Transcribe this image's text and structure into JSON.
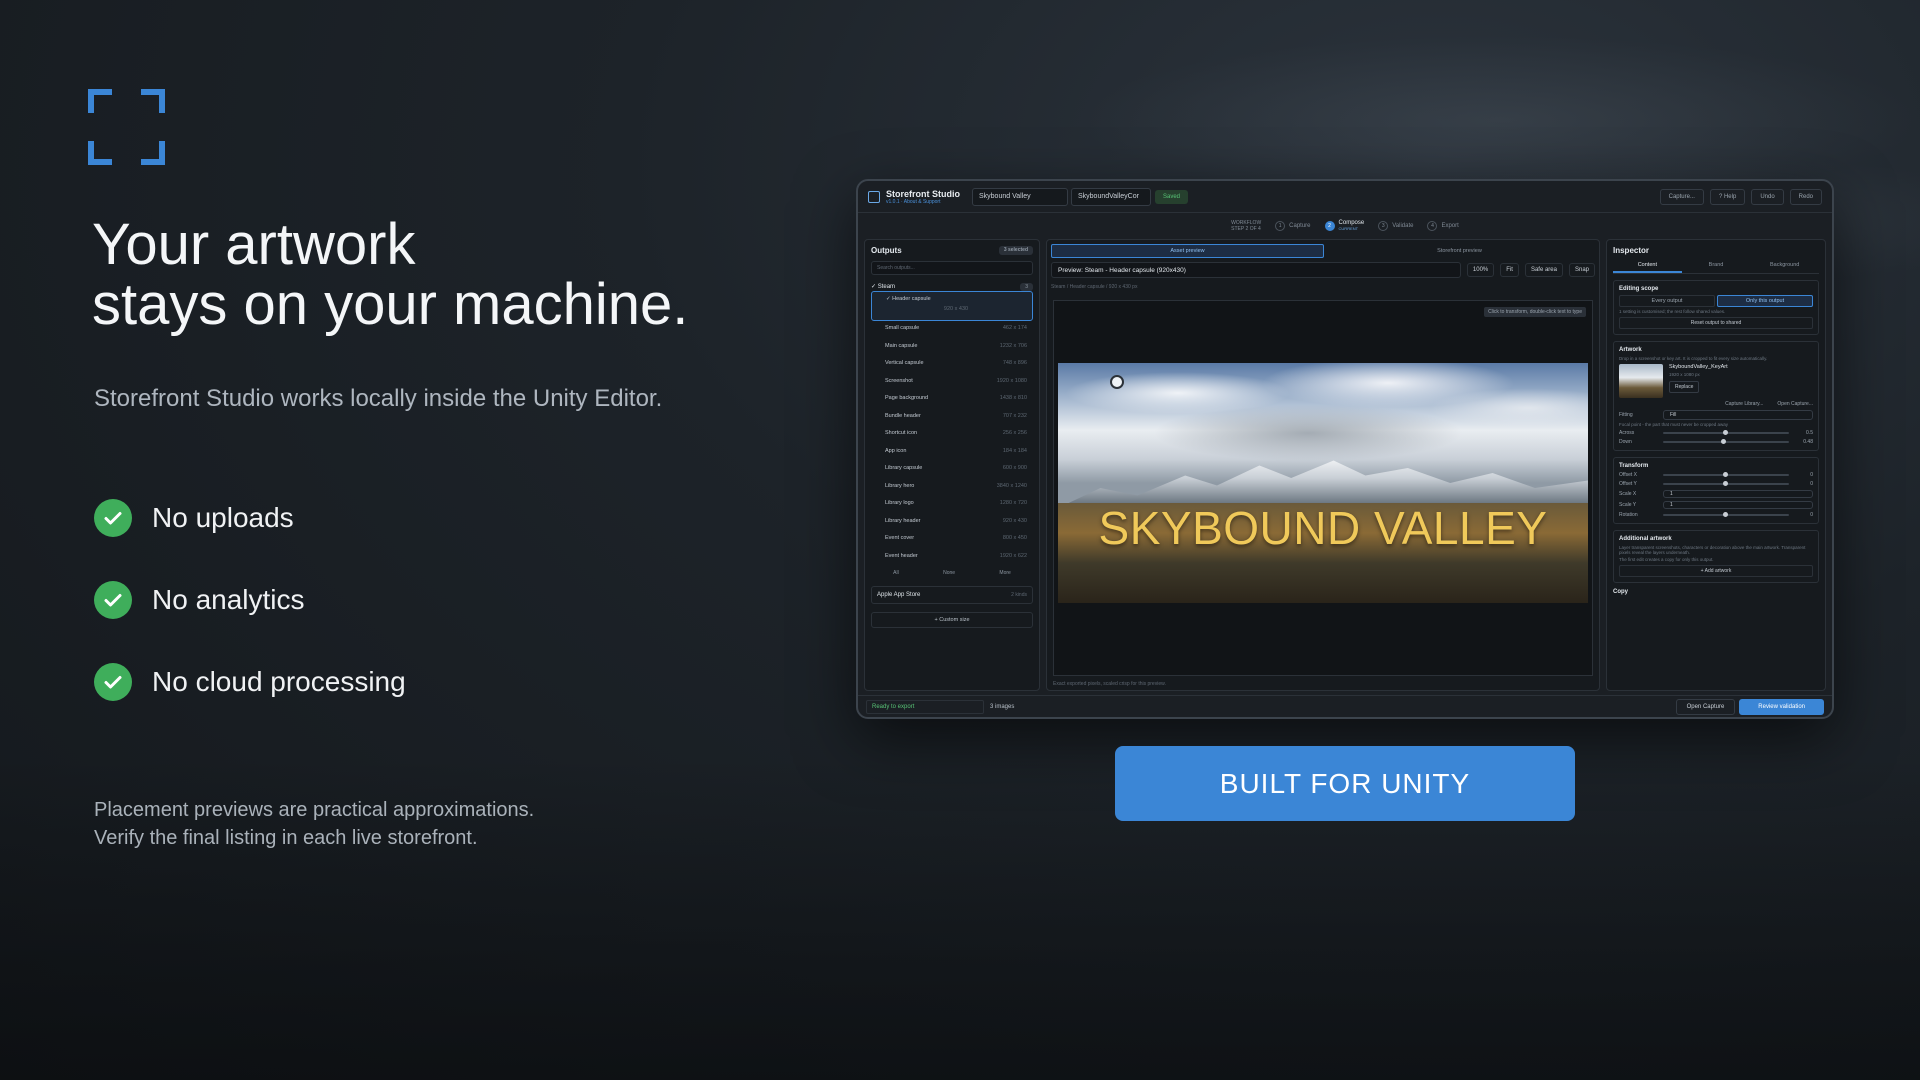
{
  "hero": {
    "logo_icon": "focus-frame-icon",
    "headline_line1": "Your artwork",
    "headline_line2": "stays on your machine.",
    "subhead": "Storefront Studio works locally inside the Unity Editor.",
    "features": [
      "No uploads",
      "No analytics",
      "No cloud processing"
    ],
    "disclaimer_line1": "Placement previews are practical approximations.",
    "disclaimer_line2": "Verify the final listing in each live storefront.",
    "cta": "BUILT FOR UNITY",
    "accent": "#3b86d6",
    "check_color": "#3fae5b"
  },
  "app": {
    "name": "Storefront Studio",
    "version": "v1.0.1 · About & Support",
    "project": "Skybound Valley",
    "asset": "SkyboundValleyCor",
    "saved": "Saved",
    "toolbar": [
      "Capture...",
      "? Help",
      "Undo",
      "Redo"
    ],
    "workflow_label": "WORKFLOW",
    "workflow_step": "STEP 2 OF 4",
    "steps": [
      {
        "n": "1",
        "label": "Capture"
      },
      {
        "n": "2",
        "label": "Compose",
        "sub": "CURRENT"
      },
      {
        "n": "3",
        "label": "Validate"
      },
      {
        "n": "4",
        "label": "Export"
      }
    ],
    "outputs": {
      "title": "Outputs",
      "selected_count": "3 selected",
      "search_placeholder": "Search outputs...",
      "group": "Steam",
      "group_count": "3",
      "selected_item": {
        "label": "Header capsule",
        "size": "920 x 430"
      },
      "items": [
        {
          "label": "Small capsule",
          "size": "462 x 174"
        },
        {
          "label": "Main capsule",
          "size": "1232 x 706"
        },
        {
          "label": "Vertical capsule",
          "size": "748 x 896"
        },
        {
          "label": "Screenshot",
          "size": "1920 x 1080"
        },
        {
          "label": "Page background",
          "size": "1438 x 810"
        },
        {
          "label": "Bundle header",
          "size": "707 x 232"
        },
        {
          "label": "Shortcut icon",
          "size": "256 x 256"
        },
        {
          "label": "App icon",
          "size": "184 x 184"
        },
        {
          "label": "Library capsule",
          "size": "600 x 900"
        },
        {
          "label": "Library hero",
          "size": "3840 x 1240"
        },
        {
          "label": "Library logo",
          "size": "1280 x 720"
        },
        {
          "label": "Library header",
          "size": "920 x 430"
        },
        {
          "label": "Event cover",
          "size": "800 x 450"
        },
        {
          "label": "Event header",
          "size": "1920 x 622"
        }
      ],
      "footer": [
        "All",
        "None",
        "More"
      ],
      "apple_group": "Apple App Store",
      "apple_count": "2 kinds",
      "custom_size": "+ Custom size"
    },
    "center": {
      "tab_asset": "Asset preview",
      "tab_store": "Storefront preview",
      "preview_select": "Preview: Steam - Header capsule (920x430)",
      "zoom": "100%",
      "fit": "Fit",
      "safe_area": "Safe area",
      "snap": "Snap",
      "breadcrumb": "Steam  /  Header capsule  /  920 x 430 px",
      "hint": "Click to transform, double-click text to type",
      "art_title": "SKYBOUND VALLEY",
      "footer": "Exact exported pixels, scaled crisp for this preview."
    },
    "inspector": {
      "title": "Inspector",
      "tabs": [
        "Content",
        "Brand",
        "Background"
      ],
      "editing_scope": "Editing scope",
      "scope_options": [
        "Every output",
        "Only this output"
      ],
      "scope_note": "1 setting is customised; the rest follow shared values.",
      "reset_label": "Reset output to shared",
      "artwork": "Artwork",
      "artwork_note": "Drop in a screenshot or key art. It is cropped to fit every size automatically.",
      "asset_name": "SkyboundValley_KeyArt",
      "asset_size": "1920 x 1080 px",
      "replace": "Replace",
      "capture_library": "Capture Library...",
      "open_capture": "Open Capture...",
      "fitting_label": "Fitting",
      "fitting_value": "Fill",
      "focal_note": "Focal point - the part that must never be cropped away",
      "across_label": "Across",
      "across_value": "0.5",
      "down_label": "Down",
      "down_value": "0.48",
      "transform": "Transform",
      "offset_x_label": "Offset X",
      "offset_x_value": "0",
      "offset_y_label": "Offset Y",
      "offset_y_value": "0",
      "scale_x_label": "Scale X",
      "scale_x_value": "1",
      "scale_y_label": "Scale Y",
      "scale_y_value": "1",
      "rotation_label": "Rotation",
      "rotation_value": "0",
      "additional": "Additional artwork",
      "additional_note": "Layer transparent screenshots, characters or decoration above the main artwork. Transparent pixels reveal the layers underneath.",
      "additional_note2": "The first edit creates a copy for only this output.",
      "add_artwork": "+ Add artwork",
      "copy": "Copy"
    },
    "status": {
      "ready": "Ready to export",
      "images": "3 images",
      "open_capture": "Open Capture",
      "review": "Review validation"
    }
  }
}
